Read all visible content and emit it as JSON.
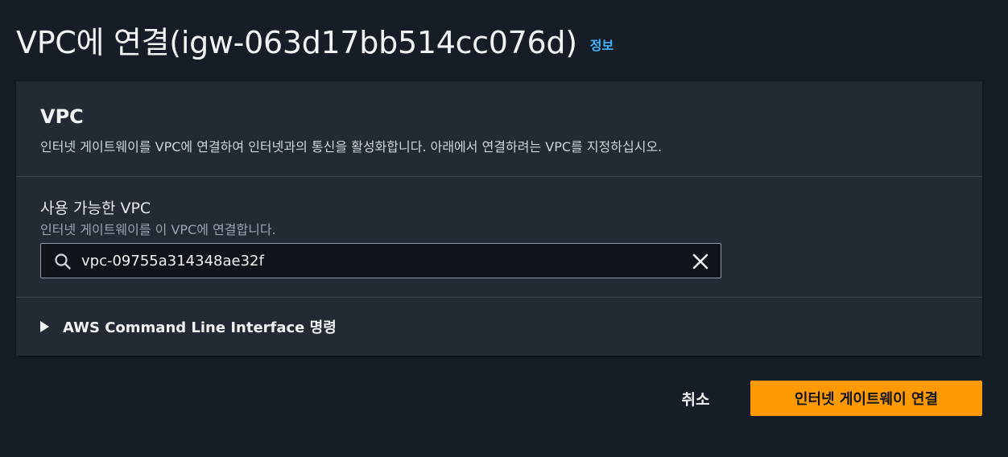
{
  "header": {
    "title": "VPC에 연결(igw-063d17bb514cc076d)",
    "info_link": "정보"
  },
  "vpc_section": {
    "title": "VPC",
    "description": "인터넷 게이트웨이를 VPC에 연결하여 인터넷과의 통신을 활성화합니다. 아래에서 연결하려는 VPC를 지정하십시오."
  },
  "available_vpc": {
    "label": "사용 가능한 VPC",
    "description": "인터넷 게이트웨이를 이 VPC에 연결합니다.",
    "search_value": "vpc-09755a314348ae32f",
    "search_icon": "search-icon",
    "clear_icon": "close-icon"
  },
  "cli_section": {
    "label": "AWS Command Line Interface 명령",
    "expanded": false
  },
  "actions": {
    "cancel_label": "취소",
    "attach_label": "인터넷 게이트웨이 연결"
  },
  "colors": {
    "background": "#161d26",
    "card": "#232a33",
    "link": "#42b4ff",
    "primary_button": "#ff9900"
  }
}
